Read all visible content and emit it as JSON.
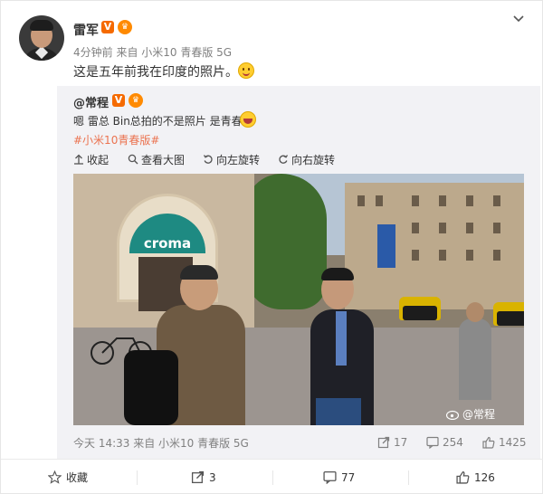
{
  "post": {
    "author": "雷军",
    "verified_badge": "V",
    "meta": "4分钟前 来自 小米10 青春版 5G",
    "text": "这是五年前我在印度的照片。",
    "emoji": "smile-emoji"
  },
  "retweet": {
    "author": "@常程",
    "verified_badge": "V",
    "text": "嗯 雷总 Bin总拍的不是照片 是青春",
    "emoji": "laugh-emoji",
    "hashtag": "#小米10青春版#",
    "tools": {
      "collapse": "收起",
      "view_large": "查看大图",
      "rotate_left": "向左旋转",
      "rotate_right": "向右旋转"
    },
    "photo": {
      "sign_text": "croma",
      "watermark": "@常程"
    },
    "footer": {
      "time": "今天 14:33 来自 小米10 青春版 5G",
      "reposts": "17",
      "comments": "254",
      "likes": "1425"
    }
  },
  "actions": {
    "favorite": "收藏",
    "repost_count": "3",
    "comment_count": "77",
    "like_count": "126"
  },
  "colors": {
    "accent": "#eb7350",
    "verified": "#f56a00",
    "croma_teal": "#1e8a82"
  }
}
